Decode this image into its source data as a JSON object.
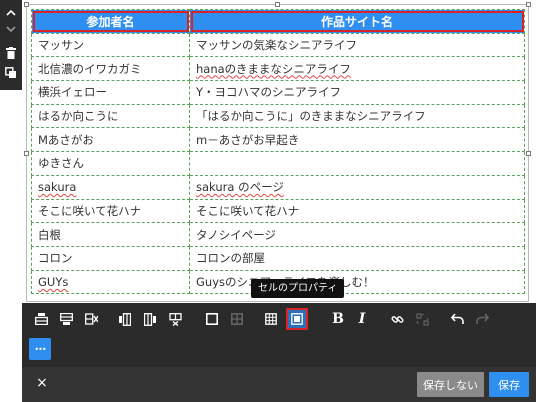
{
  "table": {
    "headers": [
      "参加者名",
      "作品サイト名"
    ],
    "rows": [
      [
        "マッサン",
        "マッサンの気楽なシニアライフ"
      ],
      [
        "北信濃のイワカガミ",
        "hanaのきままなシニアライフ"
      ],
      [
        "横浜イェロー",
        "Y・ヨコハマのシニアライフ"
      ],
      [
        "はるか向こうに",
        "「はるか向こうに」のきままなシニアライフ"
      ],
      [
        "Mあさがお",
        "m－あさがお早起き"
      ],
      [
        "ゆきさん",
        ""
      ],
      [
        "sakura",
        "sakura のページ"
      ],
      [
        "そこに咲いて花ハナ",
        "そこに咲いて花ハナ"
      ],
      [
        "白根",
        "タノシイページ"
      ],
      [
        "コロン",
        "コロンの部屋"
      ],
      [
        "GUYs",
        "Guysのシニア・ライフを楽しむ！"
      ]
    ]
  },
  "tooltip": "セルのプロパティ",
  "toolbar": {
    "icons": [
      "insert-row-above-icon",
      "insert-row-below-icon",
      "delete-row-icon",
      "insert-col-left-icon",
      "insert-col-right-icon",
      "delete-col-icon",
      "merge-cells-icon",
      "split-cells-icon",
      "table-properties-icon",
      "cell-properties-icon",
      "bold-icon",
      "italic-icon",
      "link-icon",
      "unlink-icon",
      "undo-icon",
      "redo-icon"
    ],
    "bold_label": "B",
    "italic_label": "I",
    "more_label": "•••"
  },
  "footer": {
    "close_label": "×",
    "dont_save_label": "保存しない",
    "save_label": "保存"
  },
  "colors": {
    "header_bg": "#2f8ff0",
    "highlight": "#d8232a",
    "toolbar_bg": "#2b2b2b",
    "save_bg": "#2f8ff0",
    "dont_save_bg": "#8a8a8a"
  }
}
